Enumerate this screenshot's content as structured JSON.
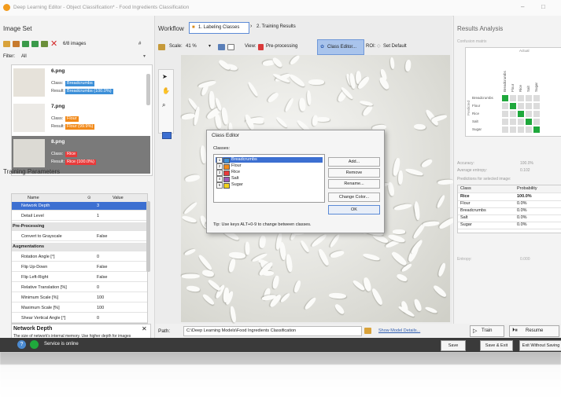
{
  "window": {
    "title": "Deep Learning Editor - Object Classification* - Food Ingredients Classification",
    "minimize": "–",
    "maximize": "□"
  },
  "image_set": {
    "title": "Image Set",
    "count": "6/8 images",
    "sort": "#",
    "filter_label": "Filter:",
    "filter_value": "All",
    "items": [
      {
        "name": "6.png",
        "class_label": "Class:",
        "class_value": "Breadcrumbs",
        "result_label": "Result:",
        "result_value": "Breadcrumbs (100.0%)",
        "color": "#3c8fd8"
      },
      {
        "name": "7.png",
        "class_label": "Class:",
        "class_value": "Flour",
        "result_label": "Result:",
        "result_value": "Flour (99.9%)",
        "color": "#f28a1a"
      },
      {
        "name": "8.png",
        "class_label": "Class:",
        "class_value": "Rice",
        "result_label": "Result:",
        "result_value": "Rice (100.0%)",
        "color": "#e83a3a"
      }
    ]
  },
  "training_params": {
    "title": "Training Parameters",
    "col_name": "Name",
    "col_value": "Value",
    "rows": [
      {
        "type": "row",
        "name": "Network Depth",
        "value": "3",
        "selected": true
      },
      {
        "type": "row",
        "name": "Detail Level",
        "value": "1"
      },
      {
        "type": "section",
        "name": "Pre-Processing"
      },
      {
        "type": "row",
        "name": "Convert to Grayscale",
        "value": "False"
      },
      {
        "type": "section",
        "name": "Augmentations"
      },
      {
        "type": "row",
        "name": "Rotation Angle [°]",
        "value": "0"
      },
      {
        "type": "row",
        "name": "Flip Up-Down",
        "value": "False"
      },
      {
        "type": "row",
        "name": "Flip Left-Right",
        "value": "False"
      },
      {
        "type": "row",
        "name": "Relative Translation [%]",
        "value": "0"
      },
      {
        "type": "row",
        "name": "Minimum Scale [%]",
        "value": "100"
      },
      {
        "type": "row",
        "name": "Maximum Scale [%]",
        "value": "100"
      },
      {
        "type": "row",
        "name": "Shear Vertical Angle [°]",
        "value": "0"
      }
    ],
    "help_title": "Network Depth",
    "help_text": "The size of network's internal memory. Use higher depth for images containing more complex patterns or higher variety of objects."
  },
  "workflow": {
    "label": "Workflow",
    "step1": "1. Labeling Classes",
    "step2": "2. Training Results",
    "scale_label": "Scale:",
    "scale_value": "41 %",
    "view_label": "View:",
    "preprocessing": "Pre-processing",
    "class_editor_btn": "Class Editor...",
    "roi_label": "ROI:",
    "set_default": "Set Default"
  },
  "class_editor": {
    "title": "Class Editor",
    "classes_label": "Classes:",
    "classes": [
      {
        "num": "1",
        "name": "Breadcrumbs",
        "color": "#3c8fd8",
        "selected": true
      },
      {
        "num": "2",
        "name": "Flour",
        "color": "#f28a1a"
      },
      {
        "num": "3",
        "name": "Rice",
        "color": "#e83a3a"
      },
      {
        "num": "4",
        "name": "Salt",
        "color": "#9b59b6"
      },
      {
        "num": "5",
        "name": "Sugar",
        "color": "#f2d21a"
      }
    ],
    "add": "Add...",
    "remove": "Remove",
    "rename": "Rename...",
    "change_color": "Change Color...",
    "ok": "OK",
    "tip": "Tip: Use keys ALT+0-9 to change between classes."
  },
  "results": {
    "title": "Results Analysis",
    "confusion_label": "Confusion matrix",
    "actual_label": "Actual",
    "predicted_label": "Predicted",
    "class_names": [
      "Breadcrumbs",
      "Flour",
      "Rice",
      "Salt",
      "Sugar"
    ],
    "matrix": [
      [
        1,
        0,
        0,
        0,
        0
      ],
      [
        0,
        1,
        0,
        0,
        0
      ],
      [
        0,
        0,
        1,
        0,
        0
      ],
      [
        0,
        0,
        0,
        1,
        0
      ],
      [
        0,
        0,
        0,
        0,
        1
      ]
    ],
    "accuracy_label": "Accuracy:",
    "accuracy_value": "100.0%",
    "entropy_avg_label": "Average entropy:",
    "entropy_avg_value": "0.102",
    "predictions_label": "Predictions for selected image:",
    "pred_col_class": "Class",
    "pred_col_prob": "Probability",
    "predictions": [
      {
        "cls": "Rice",
        "prob": "100.0%",
        "bold": true
      },
      {
        "cls": "Flour",
        "prob": "0.0%"
      },
      {
        "cls": "Breadcrumbs",
        "prob": "0.0%"
      },
      {
        "cls": "Salt",
        "prob": "0.0%"
      },
      {
        "cls": "Sugar",
        "prob": "0.0%"
      }
    ],
    "entropy_label": "Entropy:",
    "entropy_value": "0.000"
  },
  "path": {
    "label": "Path:",
    "value": "C:\\Deep Learning Models\\Food Ingredients Classification",
    "details_link": "Show Model Details...",
    "train_btn": "Train",
    "resume_btn": "Resume"
  },
  "status": {
    "service_text": "Service is online",
    "save": "Save",
    "save_exit": "Save & Exit",
    "exit_no_save": "Exit Without Saving"
  },
  "colors": {
    "accent": "#3c6fd1",
    "green": "#1fa83c",
    "status_bg": "#3a3a3a"
  }
}
